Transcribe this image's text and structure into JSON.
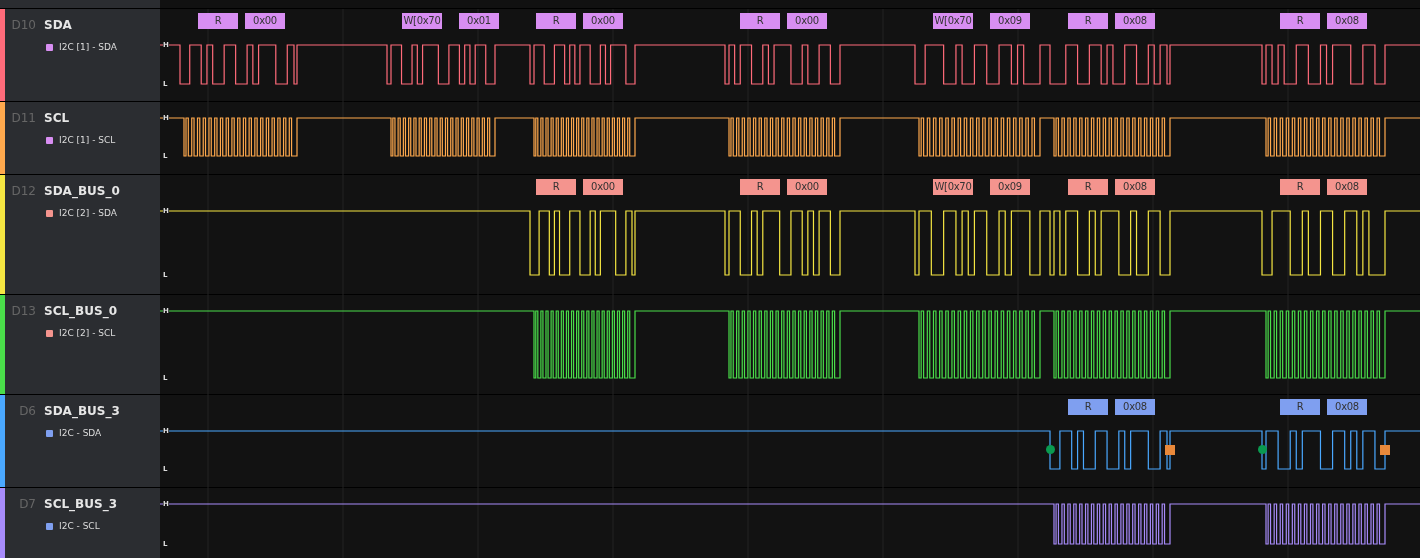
{
  "channels": [
    {
      "id": "D10",
      "name": "SDA",
      "kind": "sda",
      "color": "#ff6b7a",
      "analyzer": {
        "label": "I2C [1] - SDA",
        "color": "#d88ef2"
      },
      "high_label": "H",
      "low_label": "L",
      "decoded": [
        {
          "text": "R"
        },
        {
          "text": "0x00"
        },
        {
          "text": "W[0x70"
        },
        {
          "text": "0x01"
        },
        {
          "text": "R"
        },
        {
          "text": "0x00"
        },
        {
          "text": "R"
        },
        {
          "text": "0x00"
        },
        {
          "text": "W[0x70"
        },
        {
          "text": "0x09"
        },
        {
          "text": "R"
        },
        {
          "text": "0x08"
        },
        {
          "text": "R"
        },
        {
          "text": "0x08"
        }
      ]
    },
    {
      "id": "D11",
      "name": "SCL",
      "kind": "scl",
      "color": "#ffa94d",
      "analyzer": {
        "label": "I2C [1] - SCL",
        "color": "#d88ef2"
      },
      "high_label": "H",
      "low_label": "L"
    },
    {
      "id": "D12",
      "name": "SDA_BUS_0",
      "kind": "sda",
      "color": "#f5e642",
      "analyzer": {
        "label": "I2C [2] - SDA",
        "color": "#f4948e"
      },
      "high_label": "H",
      "low_label": "L",
      "decoded": [
        {
          "text": "R"
        },
        {
          "text": "0x00"
        },
        {
          "text": "R"
        },
        {
          "text": "0x00"
        },
        {
          "text": "W[0x70"
        },
        {
          "text": "0x09"
        },
        {
          "text": "R"
        },
        {
          "text": "0x08"
        },
        {
          "text": "R"
        },
        {
          "text": "0x08"
        }
      ]
    },
    {
      "id": "D13",
      "name": "SCL_BUS_0",
      "kind": "scl",
      "color": "#4ade4a",
      "analyzer": {
        "label": "I2C [2] - SCL",
        "color": "#f4948e"
      },
      "high_label": "H",
      "low_label": "L"
    },
    {
      "id": "D6",
      "name": "SDA_BUS_3",
      "kind": "sda",
      "color": "#4aa8ff",
      "analyzer": {
        "label": "I2C - SDA",
        "color": "#7f9ff0"
      },
      "high_label": "H",
      "low_label": "L",
      "markers": true,
      "decoded": [
        {
          "text": "R"
        },
        {
          "text": "0x08"
        },
        {
          "text": "R"
        },
        {
          "text": "0x08"
        }
      ]
    },
    {
      "id": "D7",
      "name": "SCL_BUS_3",
      "kind": "scl",
      "color": "#a78bfa",
      "analyzer": {
        "label": "I2C - SCL",
        "color": "#7f9ff0"
      },
      "high_label": "H",
      "low_label": "L"
    }
  ]
}
